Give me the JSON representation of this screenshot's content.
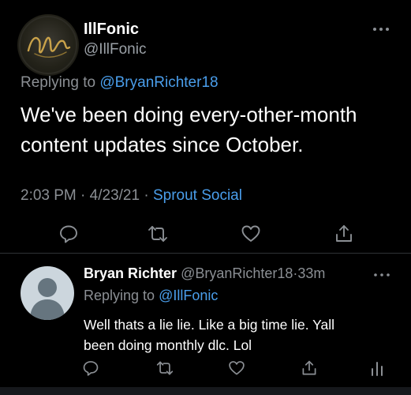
{
  "main_tweet": {
    "display_name": "IllFonic",
    "handle": "@IllFonic",
    "avatar_logo_text": "illfonic",
    "replying_prefix": "Replying to",
    "replying_to": "@BryanRichter18",
    "text_line1": "We've been doing every-other-month",
    "text_line2": "content updates since October.",
    "time": "2:03 PM",
    "sep1": "·",
    "date": "4/23/21",
    "sep2": "·",
    "source": "Sprout Social",
    "actions": [
      "comment-icon",
      "retweet-icon",
      "heart-icon",
      "share-icon"
    ]
  },
  "reply_tweet": {
    "display_name": "Bryan Richter",
    "handle": "@BryanRichter18",
    "sep": "·",
    "age": "33m",
    "replying_prefix": "Replying to",
    "replying_to": "@IllFonic",
    "text_line1": "Well thats a lie lie. Like a big time lie. Yall",
    "text_line2": "been doing monthly dlc. Lol",
    "actions": [
      "comment-icon",
      "retweet-icon",
      "heart-icon",
      "share-icon",
      "analytics-icon"
    ]
  },
  "colors": {
    "background": "#000000",
    "text_primary": "#ffffff",
    "text_secondary": "#8b8f94",
    "link": "#4a9eeb",
    "icon": "#8b8f94",
    "divider": "#2f3336",
    "logo_gold": "#c9a24a"
  }
}
